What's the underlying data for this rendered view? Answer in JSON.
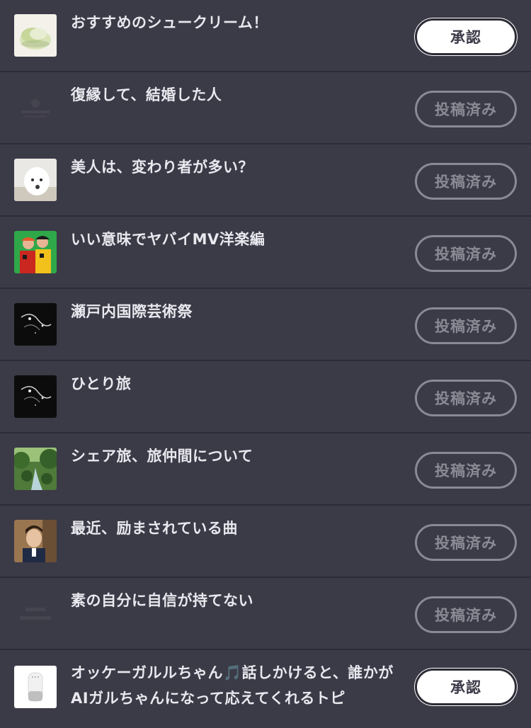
{
  "topics": [
    {
      "title": "おすすめのシュークリーム！",
      "button": "承認",
      "state": "approve",
      "thumb": "cream-puff-thumbnail"
    },
    {
      "title": "復縁して、結婚した人",
      "button": "投稿済み",
      "state": "posted",
      "thumb": "placeholder-logo-thumbnail"
    },
    {
      "title": "美人は、変わり者が多い？",
      "button": "投稿済み",
      "state": "posted",
      "thumb": "white-wolf-thumbnail"
    },
    {
      "title": "いい意味でヤバイMV洋楽編",
      "button": "投稿済み",
      "state": "posted",
      "thumb": "music-duo-thumbnail"
    },
    {
      "title": "瀬戸内国際芸術祭",
      "button": "投稿済み",
      "state": "posted",
      "thumb": "dark-artwork-thumbnail"
    },
    {
      "title": "ひとり旅",
      "button": "投稿済み",
      "state": "posted",
      "thumb": "dark-artwork-thumbnail"
    },
    {
      "title": "シェア旅、旅仲間について",
      "button": "投稿済み",
      "state": "posted",
      "thumb": "forest-river-thumbnail"
    },
    {
      "title": "最近、励まされている曲",
      "button": "投稿済み",
      "state": "posted",
      "thumb": "singer-portrait-thumbnail"
    },
    {
      "title": "素の自分に自信が持てない",
      "button": "投稿済み",
      "state": "posted",
      "thumb": "placeholder-logo-thumbnail"
    },
    {
      "title": "オッケーガルルちゃん🎵話しかけると、誰かがAIガルちゃんになって応えてくれるトピ",
      "button": "承認",
      "state": "approve",
      "thumb": "smart-speaker-thumbnail"
    }
  ]
}
